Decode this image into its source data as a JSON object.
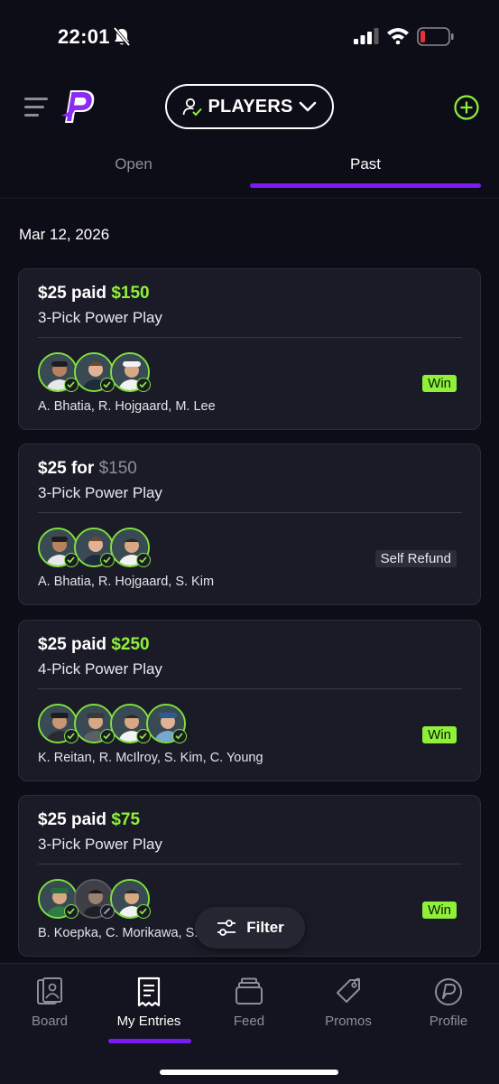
{
  "status_bar": {
    "time": "22:01"
  },
  "header": {
    "selector_label": "PLAYERS"
  },
  "tabs": [
    {
      "label": "Open"
    },
    {
      "label": "Past"
    }
  ],
  "date": "Mar 12, 2026",
  "entries": [
    {
      "stake": "$25",
      "verb": "paid",
      "payout": "$150",
      "type": "3-Pick Power Play",
      "players": "A. Bhatia, R. Hojgaard, M. Lee",
      "result": "Win"
    },
    {
      "stake": "$25",
      "verb": "for",
      "payout": "$150",
      "type": "3-Pick Power Play",
      "players": "A. Bhatia, R. Hojgaard, S. Kim",
      "result": "Self Refund"
    },
    {
      "stake": "$25",
      "verb": "paid",
      "payout": "$250",
      "type": "4-Pick Power Play",
      "players": "K. Reitan, R. McIlroy, S. Kim, C. Young",
      "result": "Win"
    },
    {
      "stake": "$25",
      "verb": "paid",
      "payout": "$75",
      "type": "3-Pick Power Play",
      "players": "B. Koepka, C. Morikawa, S.",
      "result": "Win"
    }
  ],
  "filter_label": "Filter",
  "nav": [
    {
      "label": "Board",
      "icon": "board-icon"
    },
    {
      "label": "My Entries",
      "icon": "receipt-icon"
    },
    {
      "label": "Feed",
      "icon": "feed-icon"
    },
    {
      "label": "Promos",
      "icon": "tag-icon"
    },
    {
      "label": "Profile",
      "icon": "profile-icon"
    }
  ],
  "colors": {
    "accent_purple": "#7a1cf0",
    "win_green": "#8ff03a",
    "background": "#0d0d17",
    "card": "#1b1b27"
  }
}
